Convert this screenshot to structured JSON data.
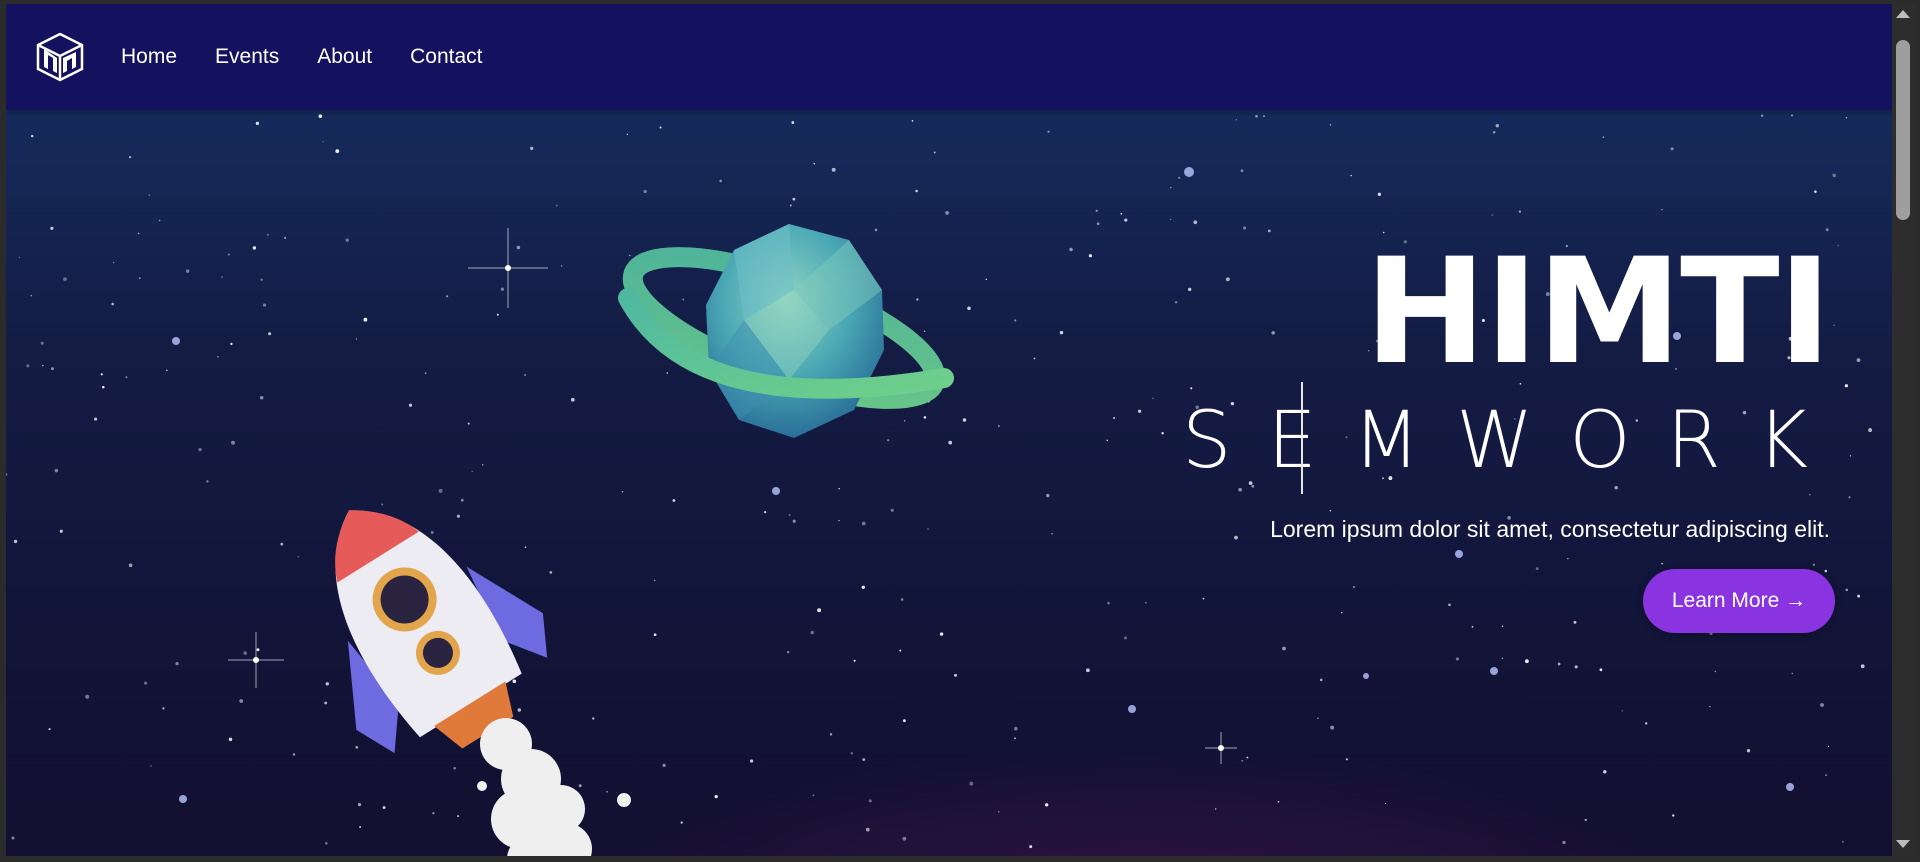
{
  "nav": {
    "links": [
      "Home",
      "Events",
      "About",
      "Contact"
    ]
  },
  "hero": {
    "title": "HIMTI",
    "subtitle": "SEMWORK",
    "description": "Lorem ipsum dolor sit amet, consectetur adipiscing elit.",
    "cta_label": "Learn More →"
  },
  "colors": {
    "navbar": "#14125e",
    "accent": "#8a33e0",
    "background_top": "#16346a",
    "background_bottom": "#130f30"
  },
  "icons": {
    "logo": "himti-cube-logo-icon"
  }
}
